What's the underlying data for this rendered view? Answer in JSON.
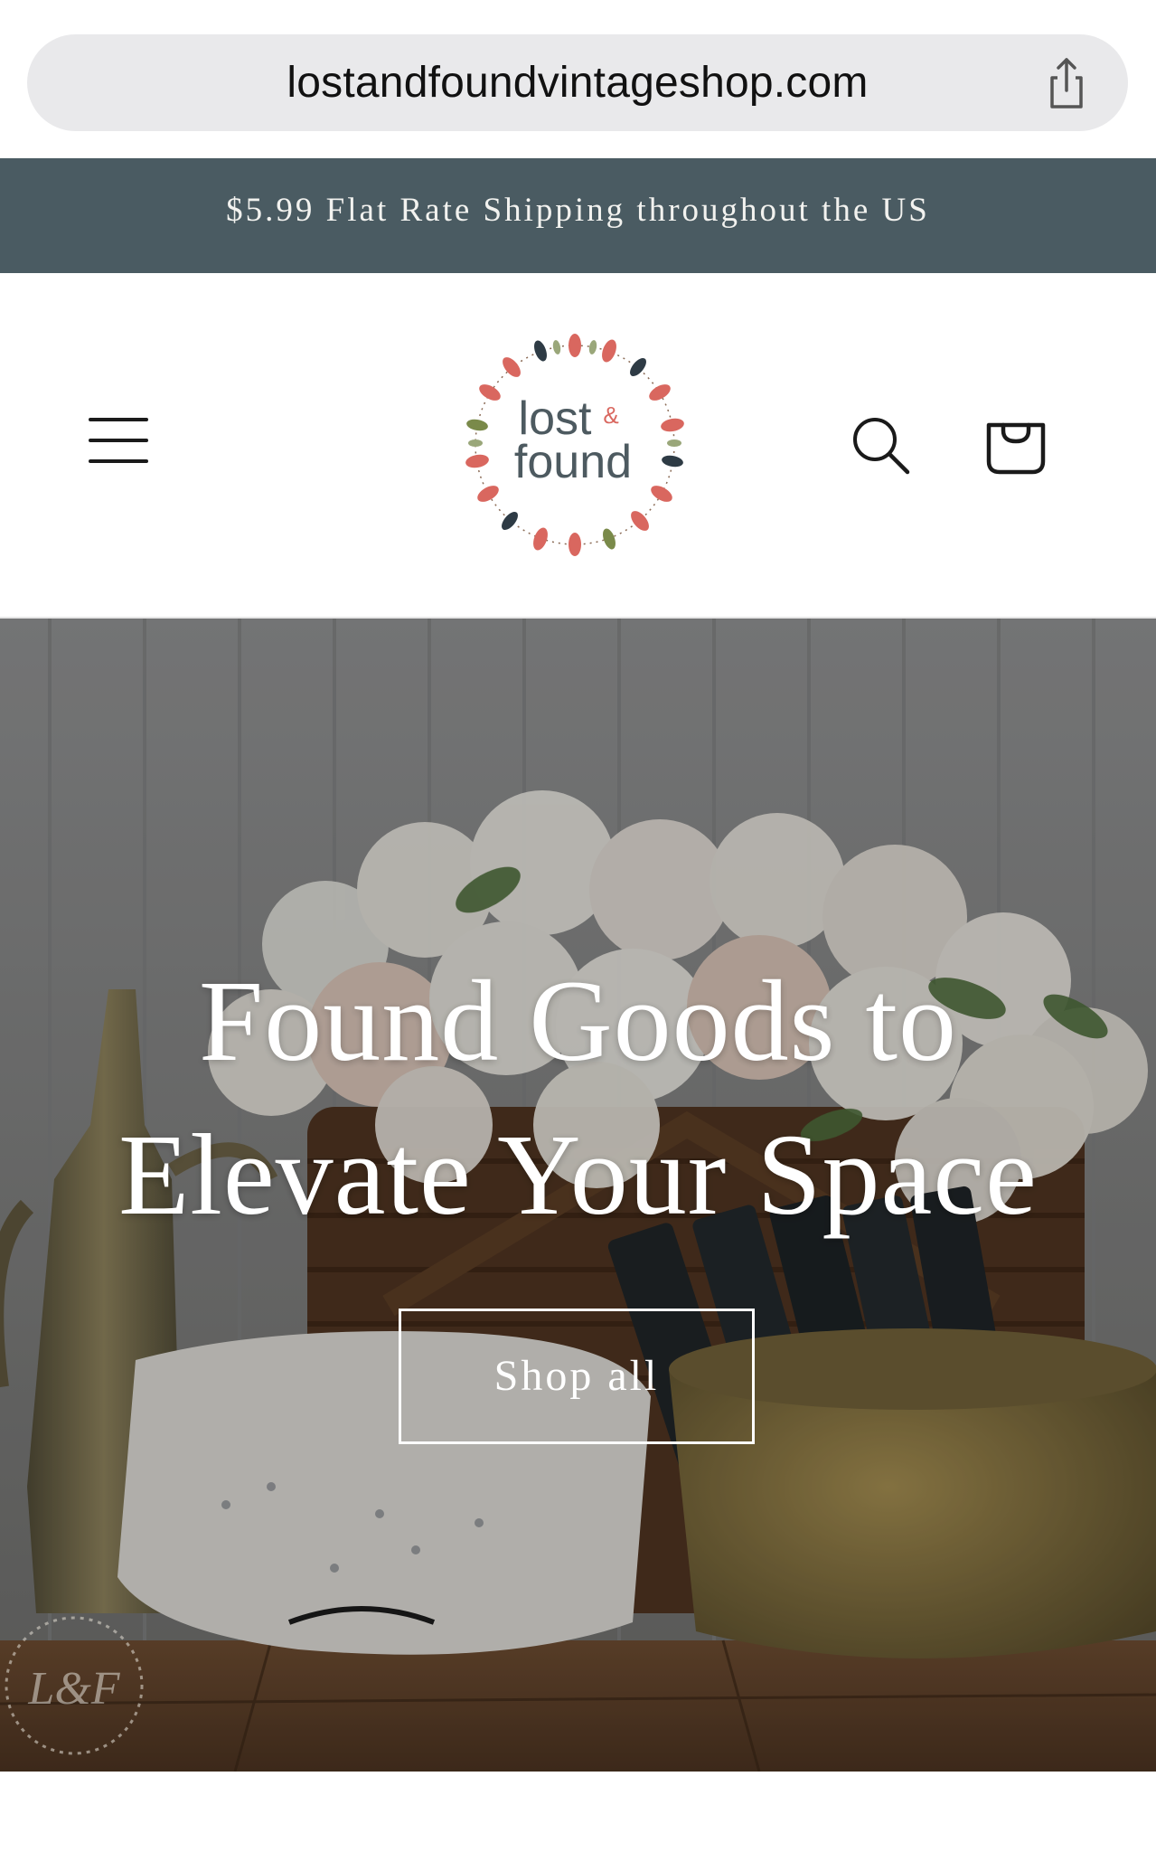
{
  "browser": {
    "url": "lostandfoundvintageshop.com",
    "share_icon": "share-icon"
  },
  "announcement": {
    "text": "$5.99 Flat Rate Shipping throughout the US",
    "background_color": "#4a5b62"
  },
  "header": {
    "menu_icon": "hamburger-menu-icon",
    "logo_text_line1": "lost",
    "logo_ampersand": "&",
    "logo_text_line2": "found",
    "search_icon": "search-icon",
    "cart_icon": "shopping-bag-icon"
  },
  "hero": {
    "title": "Found Goods to\nElevate Your Space",
    "button_label": "Shop all",
    "watermark": "L&F"
  }
}
